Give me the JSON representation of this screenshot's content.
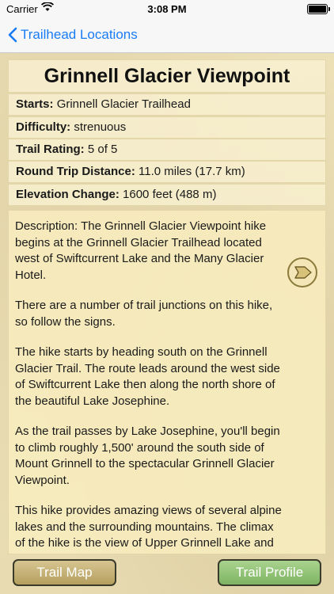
{
  "status": {
    "carrier": "Carrier",
    "time": "3:08 PM"
  },
  "nav": {
    "back_label": "Trailhead Locations"
  },
  "trail": {
    "name": "Grinnell Glacier Viewpoint",
    "starts_label": "Starts:",
    "starts_value": "Grinnell Glacier Trailhead",
    "difficulty_label": "Difficulty:",
    "difficulty_value": "strenuous",
    "rating_label": "Trail Rating:",
    "rating_value": "5 of 5",
    "distance_label": "Round Trip Distance:",
    "distance_value": "11.0 miles (17.7 km)",
    "elevation_label": "Elevation Change:",
    "elevation_value": "1600 feet (488 m)"
  },
  "description": {
    "p1": "Description: The Grinnell Glacier Viewpoint hike begins at the Grinnell Glacier Trailhead located west of Swiftcurrent Lake and the Many Glacier Hotel.",
    "p2": "There are a number of trail junctions on this hike, so follow the signs.",
    "p3": "The hike starts by heading south on the Grinnell Glacier Trail. The route leads around the west side of Swiftcurrent Lake then along the north shore of the beautiful Lake Josephine.",
    "p4": "As the trail passes by Lake Josephine, you'll begin to climb roughly 1,500' around the south side of Mount Grinnell to the spectacular Grinnell Glacier Viewpoint.",
    "p5": "This hike provides amazing views of several alpine lakes and the surrounding mountains. The climax of the hike is the view of Upper Grinnell Lake and Grinnell Glacier."
  },
  "buttons": {
    "map": "Trail Map",
    "profile": "Trail Profile"
  },
  "colors": {
    "accent": "#1a7cf5",
    "map_button": "#c7b476",
    "profile_button": "#93c477"
  }
}
